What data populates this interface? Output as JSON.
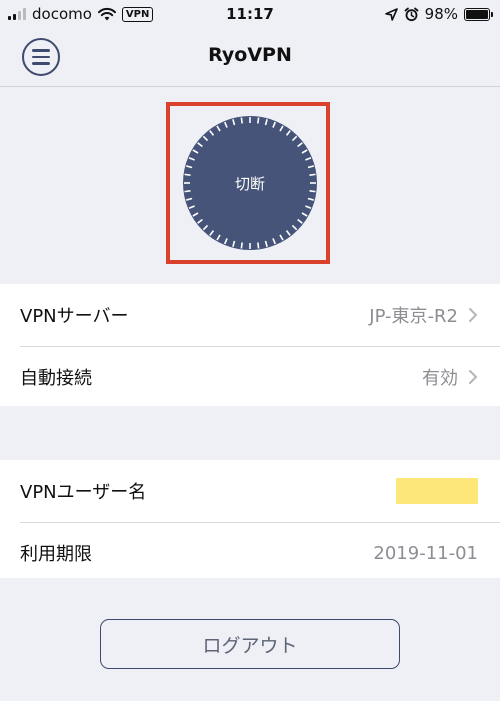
{
  "status_bar": {
    "carrier": "docomo",
    "vpn_badge": "VPN",
    "time": "11:17",
    "battery": "98%",
    "battery_level": 0.98
  },
  "nav": {
    "title": "RyoVPN",
    "menu_icon": "hamburger-icon"
  },
  "dial": {
    "label": "切断",
    "color": "#47547a",
    "highlight_color": "#d9412d"
  },
  "settings": [
    {
      "label": "VPNサーバー",
      "value": "JP-東京-R2"
    },
    {
      "label": "自動接続",
      "value": "有効"
    }
  ],
  "account": {
    "username_label": "VPNユーザー名",
    "expiry_label": "利用期限",
    "expiry_value": "2019-11-01"
  },
  "logout_label": "ログアウト"
}
